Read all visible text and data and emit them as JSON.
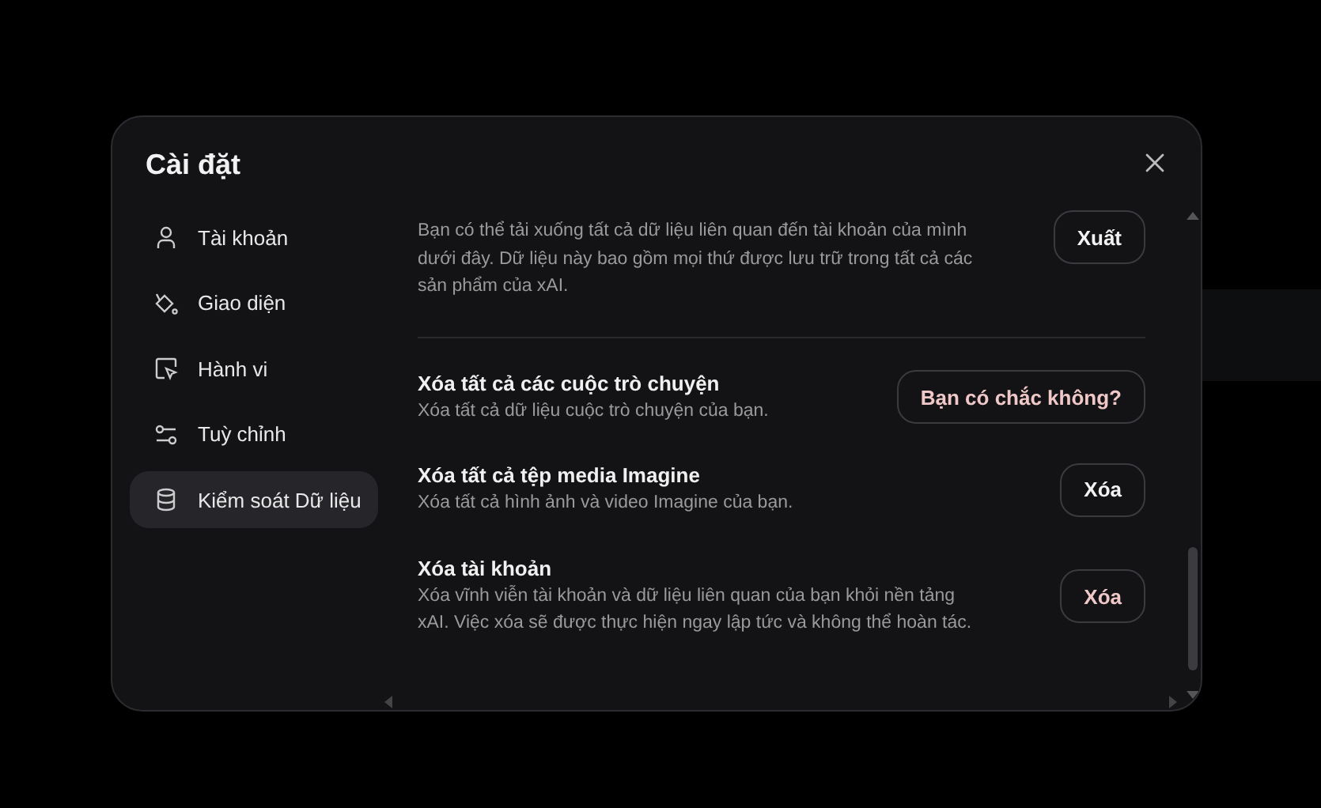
{
  "dialog": {
    "title": "Cài đặt"
  },
  "sidebar": {
    "items": [
      {
        "label": "Tài khoản",
        "selected": false
      },
      {
        "label": "Giao diện",
        "selected": false
      },
      {
        "label": "Hành vi",
        "selected": false
      },
      {
        "label": "Tuỳ chỉnh",
        "selected": false
      },
      {
        "label": "Kiểm soát Dữ liệu",
        "selected": true
      }
    ]
  },
  "sections": [
    {
      "description": "Bạn có thể tải xuống tất cả dữ liệu liên quan đến tài khoản của mình dưới đây. Dữ liệu này bao gồm mọi thứ được lưu trữ trong tất cả các sản phẩm của xAI.",
      "button": "Xuất",
      "danger": false
    },
    {
      "title": "Xóa tất cả các cuộc trò chuyện",
      "description": "Xóa tất cả dữ liệu cuộc trò chuyện của bạn.",
      "button": "Bạn có chắc không?",
      "danger": true
    },
    {
      "title": "Xóa tất cả tệp media Imagine",
      "description": "Xóa tất cả hình ảnh và video Imagine của bạn.",
      "button": "Xóa",
      "danger": false
    },
    {
      "title": "Xóa tài khoản",
      "description": "Xóa vĩnh viễn tài khoản và dữ liệu liên quan của bạn khỏi nền tảng xAI. Việc xóa sẽ được thực hiện ngay lập tức và không thể hoàn tác.",
      "button": "Xóa",
      "danger": true
    }
  ]
}
